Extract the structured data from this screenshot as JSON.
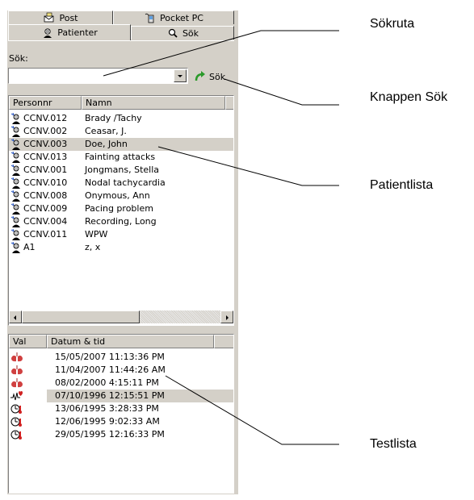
{
  "tabs": {
    "post": "Post",
    "pocket_pc": "Pocket PC",
    "patienter": "Patienter",
    "sok": "Sök"
  },
  "search": {
    "label": "Sök:",
    "value": "",
    "button": "Sök"
  },
  "patient_list": {
    "columns": [
      "Personnr",
      "Namn"
    ],
    "rows": [
      {
        "id": "CCNV.012",
        "name": "Brady /Tachy"
      },
      {
        "id": "CCNV.002",
        "name": "Ceasar, J."
      },
      {
        "id": "CCNV.003",
        "name": "Doe, John"
      },
      {
        "id": "CCNV.013",
        "name": "Fainting attacks"
      },
      {
        "id": "CCNV.001",
        "name": "Jongmans, Stella"
      },
      {
        "id": "CCNV.010",
        "name": "Nodal tachycardia"
      },
      {
        "id": "CCNV.008",
        "name": "Onymous, Ann"
      },
      {
        "id": "CCNV.009",
        "name": "Pacing problem"
      },
      {
        "id": "CCNV.004",
        "name": "Recording, Long"
      },
      {
        "id": "CCNV.011",
        "name": "WPW"
      },
      {
        "id": "A1",
        "name": "z, x"
      }
    ],
    "selected_row": "CCNV.003"
  },
  "test_list": {
    "columns": [
      "Val",
      "Datum & tid"
    ],
    "rows": [
      {
        "icon": "lungs-icon",
        "datetime": "15/05/2007 11:13:36 PM"
      },
      {
        "icon": "lungs-icon",
        "datetime": "11/04/2007 11:44:26 AM"
      },
      {
        "icon": "lungs-icon",
        "datetime": "08/02/2000 4:15:11 PM"
      },
      {
        "icon": "ecg-heart-icon",
        "datetime": "07/10/1996 12:15:51 PM"
      },
      {
        "icon": "clock-thermometer-icon",
        "datetime": "13/06/1995 3:28:33 PM"
      },
      {
        "icon": "clock-thermometer-icon",
        "datetime": "12/06/1995 9:02:33 AM"
      },
      {
        "icon": "clock-thermometer-icon",
        "datetime": "29/05/1995 12:16:33 PM"
      }
    ],
    "selected_row": "07/10/1996 12:15:51 PM"
  },
  "callouts": {
    "sokruta": "Sökruta",
    "knappen_sok": "Knappen Sök",
    "patientlista": "Patientlista",
    "testlista": "Testlista"
  },
  "colors": {
    "panel": "#d4d0c8",
    "lungs": "#d04040",
    "selected": "#d4d0c8"
  }
}
